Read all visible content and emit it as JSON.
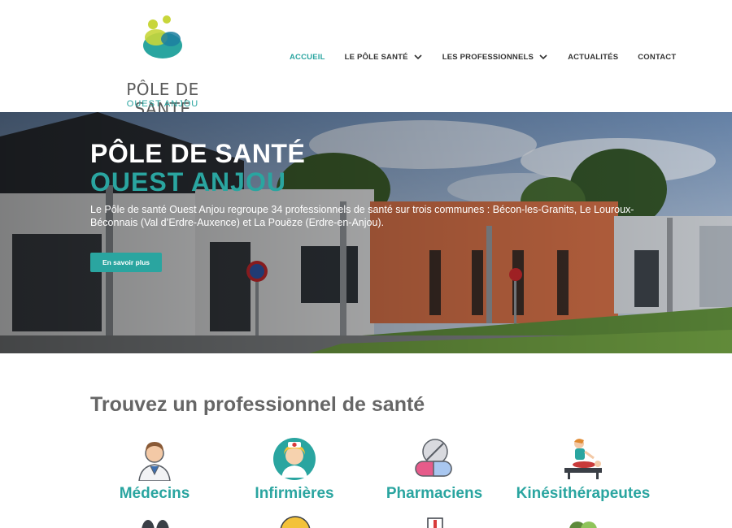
{
  "logo": {
    "title": "PÔLE DE SANTÉ",
    "subtitle": "OUEST ANJOU"
  },
  "nav": {
    "items": [
      {
        "label": "ACCUEIL",
        "active": true,
        "dropdown": false
      },
      {
        "label": "LE PÔLE SANTÉ",
        "active": false,
        "dropdown": true
      },
      {
        "label": "LES PROFESSIONNELS",
        "active": false,
        "dropdown": true
      },
      {
        "label": "ACTUALITÉS",
        "active": false,
        "dropdown": false
      },
      {
        "label": "CONTACT",
        "active": false,
        "dropdown": false
      }
    ]
  },
  "hero": {
    "title_line1": "PÔLE DE SANTÉ",
    "title_line2": "OUEST ANJOU",
    "description": "Le Pôle de santé Ouest Anjou regroupe 34 professionnels de santé sur trois communes : Bécon-les-Granits, Le Louroux-Béconnais (Val d’Erdre-Auxence) et La Pouëze (Erdre-en-Anjou).",
    "button_label": "En savoir plus"
  },
  "section": {
    "title": "Trouvez un professionnel de santé",
    "categories": [
      {
        "label": "Médecins",
        "icon": "doctor-icon"
      },
      {
        "label": "Infirmières",
        "icon": "nurse-icon"
      },
      {
        "label": "Pharmaciens",
        "icon": "pills-icon"
      },
      {
        "label": "Kinésithérapeutes",
        "icon": "physiotherapy-icon"
      }
    ]
  },
  "colors": {
    "accent": "#2aa5a0",
    "text_dark": "#333333",
    "heading_grey": "#666666"
  }
}
